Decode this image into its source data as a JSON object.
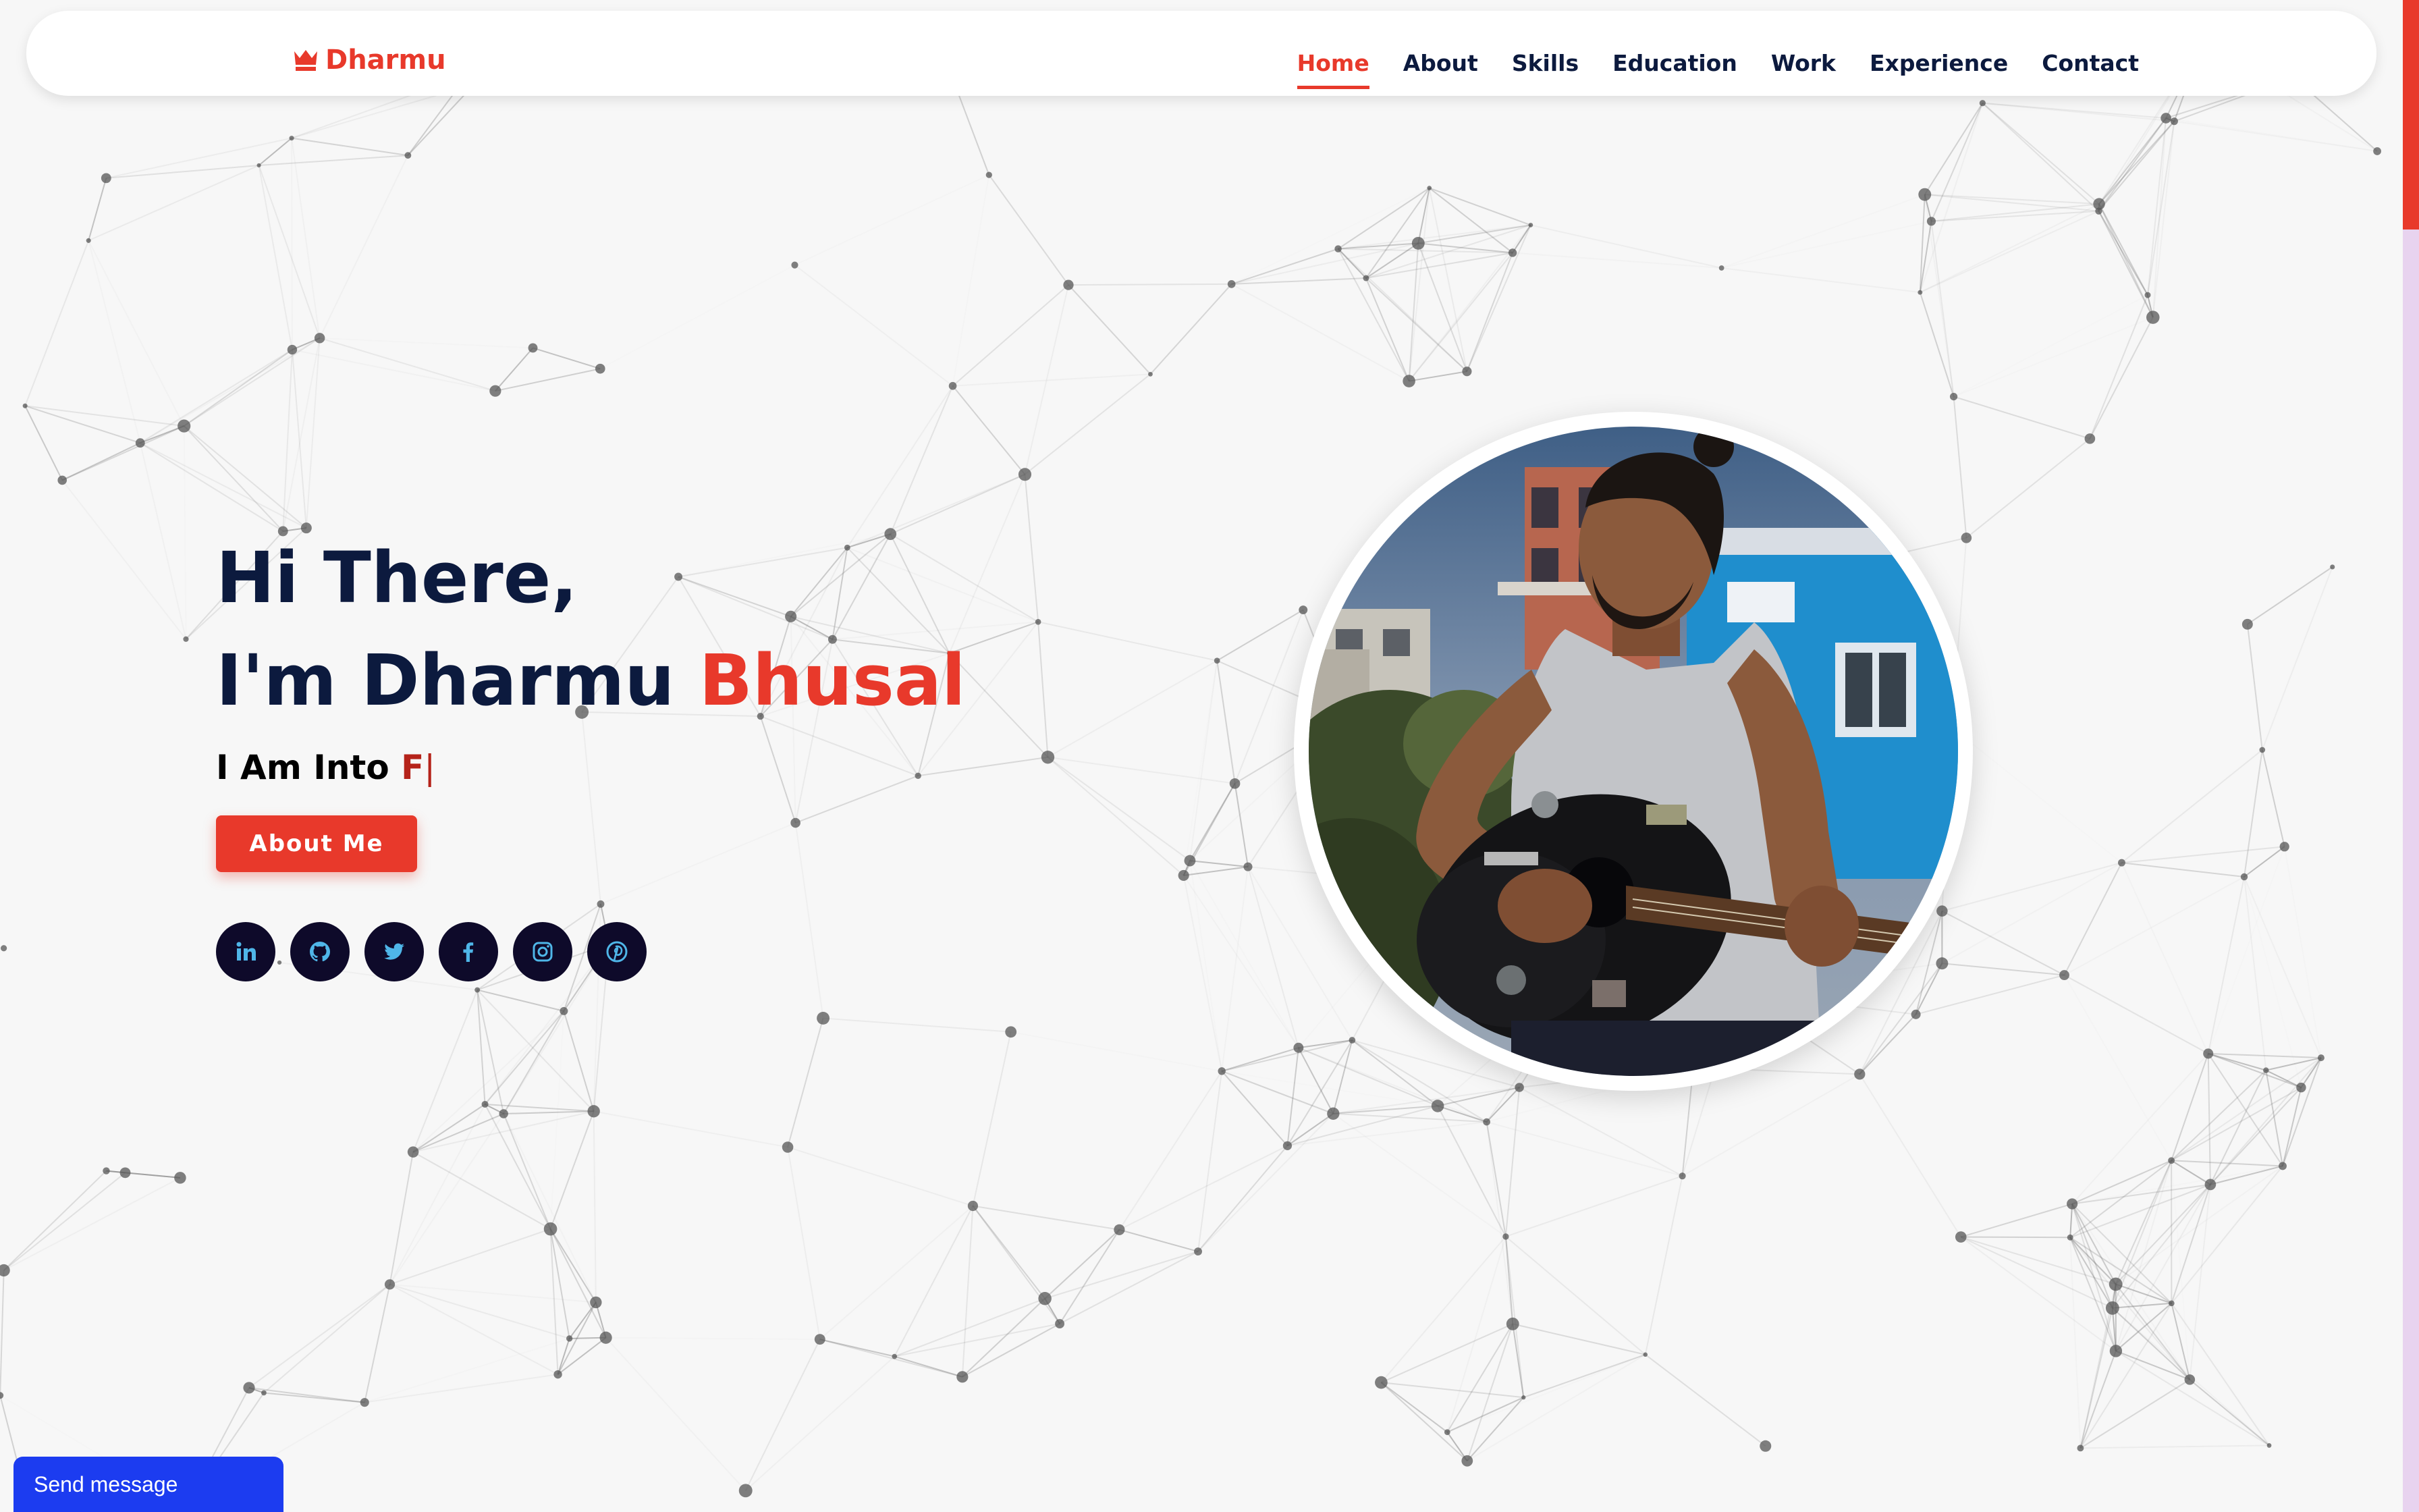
{
  "brand": {
    "name": "Dharmu",
    "accent": "#e8392b"
  },
  "nav": {
    "items": [
      {
        "label": "Home",
        "active": true
      },
      {
        "label": "About"
      },
      {
        "label": "Skills"
      },
      {
        "label": "Education"
      },
      {
        "label": "Work"
      },
      {
        "label": "Experience"
      },
      {
        "label": "Contact"
      }
    ]
  },
  "hero": {
    "greeting": "Hi There,",
    "intro": "I'm Dharmu",
    "surname": "Bhusal",
    "typed_prefix": "I Am Into",
    "typed_word": "F",
    "cursor": "|",
    "button_label": "About Me"
  },
  "socials": [
    {
      "icon": "linkedin-icon"
    },
    {
      "icon": "github-icon"
    },
    {
      "icon": "twitter-icon"
    },
    {
      "icon": "facebook-icon"
    },
    {
      "icon": "instagram-icon"
    },
    {
      "icon": "pinterest-icon"
    }
  ],
  "chat": {
    "label": "Send message",
    "color": "#1c3cf0"
  },
  "colors": {
    "navy": "#0c1a3e",
    "red": "#e8392b",
    "background": "#f7f7f7",
    "social_bg": "#0e0a2a",
    "social_icon": "#4fb6e8"
  }
}
